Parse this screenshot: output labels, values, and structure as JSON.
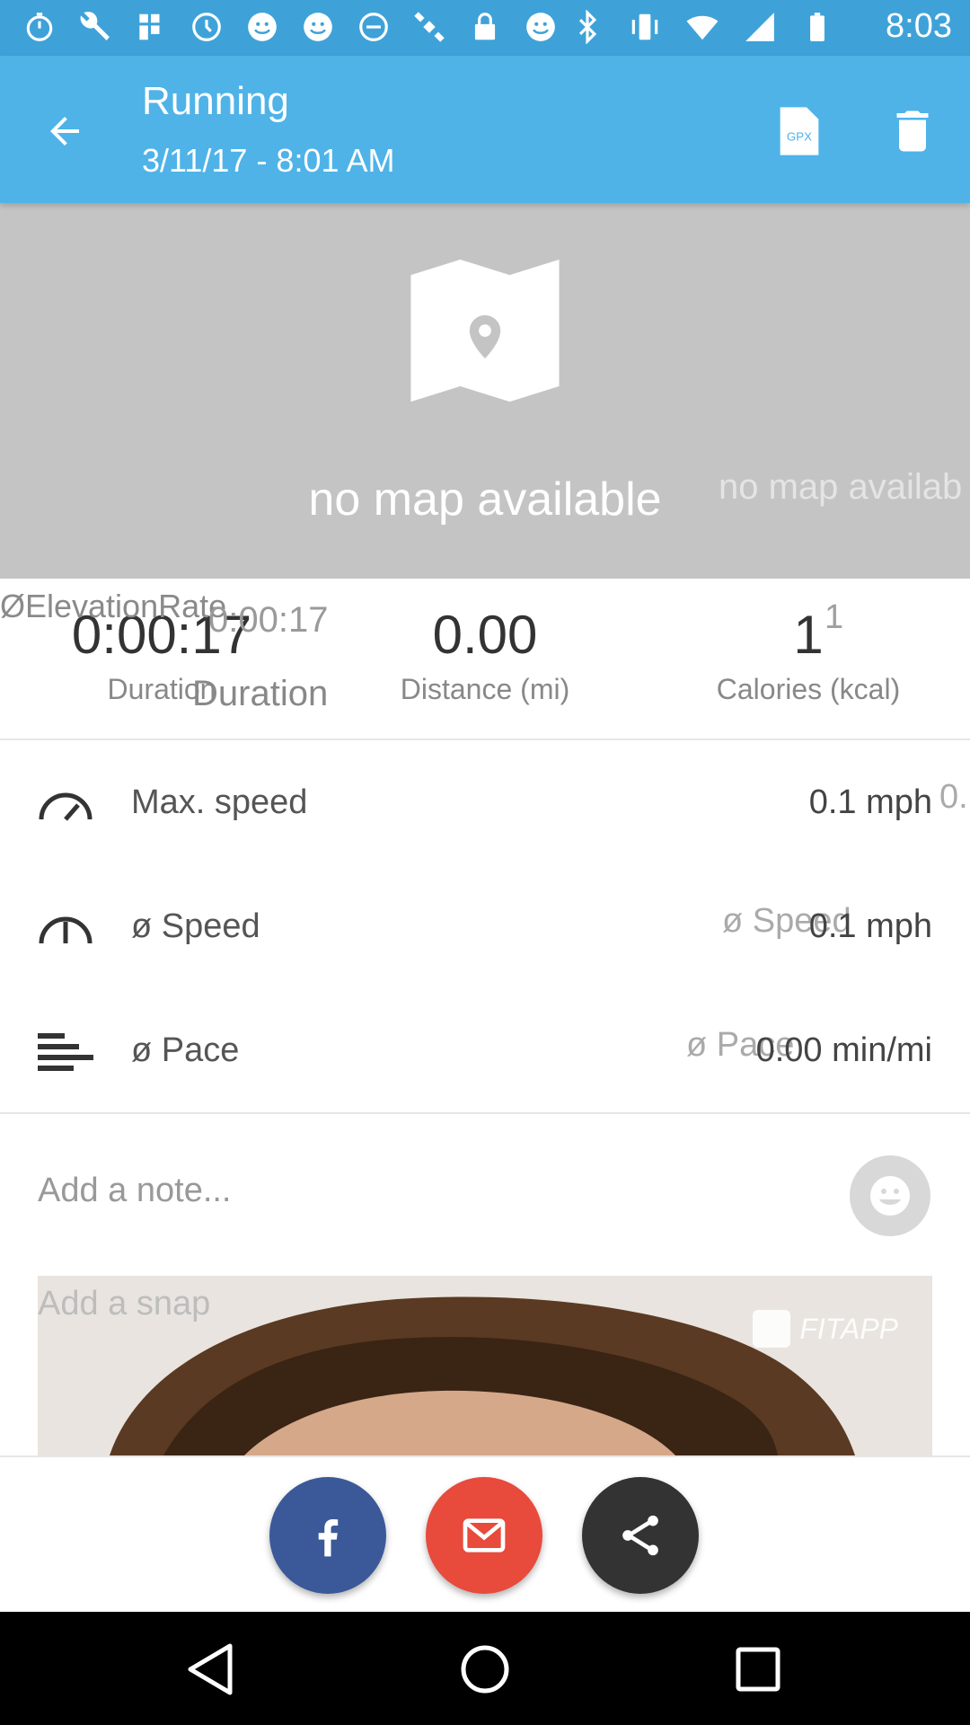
{
  "status_bar": {
    "time": "8:03",
    "icons_left": [
      "stopwatch-icon",
      "wrench-icon",
      "flag-icon",
      "timer-icon",
      "smiley-icon",
      "smiley-icon",
      "circle-icon",
      "satellite-icon",
      "lock-icon",
      "smiley-icon"
    ],
    "icons_right": [
      "bluetooth-icon",
      "vibrate-icon",
      "wifi-icon",
      "signal-icon",
      "battery-icon"
    ]
  },
  "app_bar": {
    "title": "Running",
    "subtitle": "3/11/17 - 8:01 AM",
    "gpx_label": "GPX",
    "accent_color": "#4fb3e8"
  },
  "map": {
    "message": "no map available",
    "ghost_message": "no map availab"
  },
  "stats": {
    "duration": {
      "value": "0:00:17",
      "label": "Duration"
    },
    "distance": {
      "value": "0.00",
      "label": "Distance (mi)"
    },
    "calories": {
      "value": "1",
      "label": "Calories (kcal)"
    },
    "ghost_overlap": "ØElevationRate",
    "ghost_time": "0:00:17",
    "ghost_duration": "Duration",
    "ghost_calories": "1"
  },
  "details": [
    {
      "name": "Max. speed",
      "value": "0.1 mph",
      "ghost": "0."
    },
    {
      "name": "ø Speed",
      "value": "0.1 mph",
      "ghost": "ø Speed"
    },
    {
      "name": "ø Pace",
      "value": "0.00 min/mi",
      "ghost": "ø Pace"
    }
  ],
  "note": {
    "placeholder": "Add a note..."
  },
  "snap": {
    "label": "Add a snap",
    "brand": "FITAPP"
  },
  "share": {
    "facebook_color": "#3b5998",
    "mail_color": "#e84a3c",
    "share_color": "#333333"
  }
}
